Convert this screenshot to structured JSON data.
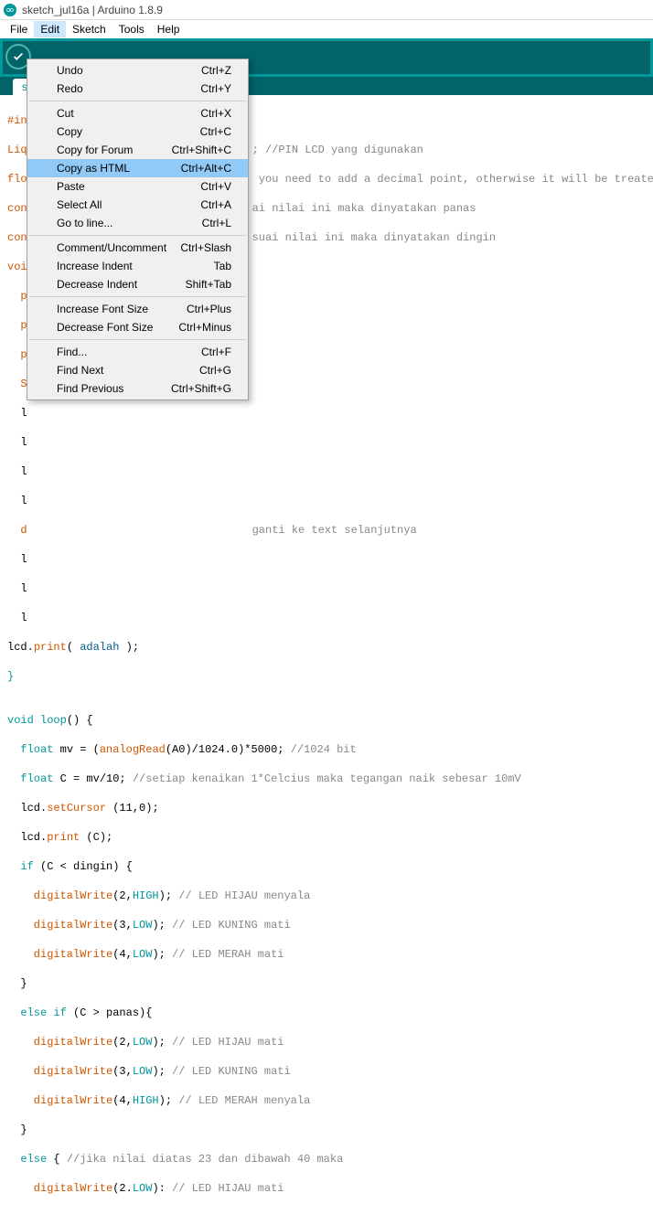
{
  "window": {
    "title": "sketch_jul16a | Arduino 1.8.9"
  },
  "menubar": [
    "File",
    "Edit",
    "Sketch",
    "Tools",
    "Help"
  ],
  "open_menu_index": 1,
  "tab": {
    "label": "s"
  },
  "dropdown": [
    {
      "label": "Undo",
      "shortcut": "Ctrl+Z"
    },
    {
      "label": "Redo",
      "shortcut": "Ctrl+Y"
    },
    {
      "sep": true
    },
    {
      "label": "Cut",
      "shortcut": "Ctrl+X"
    },
    {
      "label": "Copy",
      "shortcut": "Ctrl+C"
    },
    {
      "label": "Copy for Forum",
      "shortcut": "Ctrl+Shift+C"
    },
    {
      "label": "Copy as HTML",
      "shortcut": "Ctrl+Alt+C",
      "hl": true
    },
    {
      "label": "Paste",
      "shortcut": "Ctrl+V"
    },
    {
      "label": "Select All",
      "shortcut": "Ctrl+A"
    },
    {
      "label": "Go to line...",
      "shortcut": "Ctrl+L"
    },
    {
      "sep": true
    },
    {
      "label": "Comment/Uncomment",
      "shortcut": "Ctrl+Slash"
    },
    {
      "label": "Increase Indent",
      "shortcut": "Tab"
    },
    {
      "label": "Decrease Indent",
      "shortcut": "Shift+Tab"
    },
    {
      "sep": true
    },
    {
      "label": "Increase Font Size",
      "shortcut": "Ctrl+Plus"
    },
    {
      "label": "Decrease Font Size",
      "shortcut": "Ctrl+Minus"
    },
    {
      "sep": true
    },
    {
      "label": "Find...",
      "shortcut": "Ctrl+F"
    },
    {
      "label": "Find Next",
      "shortcut": "Ctrl+G"
    },
    {
      "label": "Find Previous",
      "shortcut": "Ctrl+Shift+G"
    }
  ],
  "code": {
    "l1_a": "#in",
    "l2_a": "Liq",
    "l2_b": "; //PIN LCD yang digunakan",
    "l3_a": "flo",
    "l3_b": " you need to add a decimal point, otherwise it will be treated",
    "l4_a": "con",
    "l4_b": "ai nilai ini maka dinyatakan panas",
    "l5_a": "con",
    "l5_b": "suai nilai ini maka dinyatakan dingin",
    "l6": "voi",
    "l7": "  p",
    "l8": "  p",
    "l9": "  p",
    "l10": "  S",
    "l11": "  l",
    "l12": "  l",
    "l13": "  l",
    "l14": "  l",
    "l15a": "  d",
    "l15b": "ganti ke text selanjutnya",
    "l16": "  l",
    "l17": "  l",
    "l18": "  l",
    "l19a": "lcd.",
    "l19b": "print",
    "l19c": "( ",
    "l19d": "adalah ",
    "l19e": ");",
    "l20": "}",
    "blank": "",
    "l21a": "void",
    "l21b": " loop",
    "l21c": "() {",
    "l22a": "  float",
    "l22b": " mv = (",
    "l22c": "analogRead",
    "l22d": "(A0)/1024.0)*5000; ",
    "l22e": "//1024 bit",
    "l23a": "  float",
    "l23b": " C = mv/10; ",
    "l23c": "//setiap kenaikan 1*Celcius maka tegangan naik sebesar 10mV",
    "l24a": "  lcd.",
    "l24b": "setCursor",
    "l24c": " (11,0);",
    "l25a": "  lcd.",
    "l25b": "print",
    "l25c": " (C);",
    "l26a": "  if",
    "l26b": " (C < dingin) {",
    "l27a": "    digitalWrite",
    "l27b": "(2,",
    "l27c": "HIGH",
    "l27d": "); ",
    "l27e": "// LED HIJAU menyala",
    "l28a": "    digitalWrite",
    "l28b": "(3,",
    "l28c": "LOW",
    "l28d": "); ",
    "l28e": "// LED KUNING mati",
    "l29a": "    digitalWrite",
    "l29b": "(4,",
    "l29c": "LOW",
    "l29d": "); ",
    "l29e": "// LED MERAH mati",
    "l30": "  }",
    "l31a": "  else if",
    "l31b": " (C > panas){",
    "l32a": "    digitalWrite",
    "l32b": "(2,",
    "l32c": "LOW",
    "l32d": "); ",
    "l32e": "// LED HIJAU mati",
    "l33a": "    digitalWrite",
    "l33b": "(3,",
    "l33c": "LOW",
    "l33d": "); ",
    "l33e": "// LED KUNING mati",
    "l34a": "    digitalWrite",
    "l34b": "(4,",
    "l34c": "HIGH",
    "l34d": "); ",
    "l34e": "// LED MERAH menyala",
    "l35": "  }",
    "l36a": "  else",
    "l36b": " { ",
    "l36c": "//jika nilai diatas 23 dan dibawah 40 maka",
    "l37a": "    digitalWrite",
    "l37b": "(2.",
    "l37c": "LOW",
    "l37d": "): ",
    "l37e": "// LED HIJAU mati"
  }
}
